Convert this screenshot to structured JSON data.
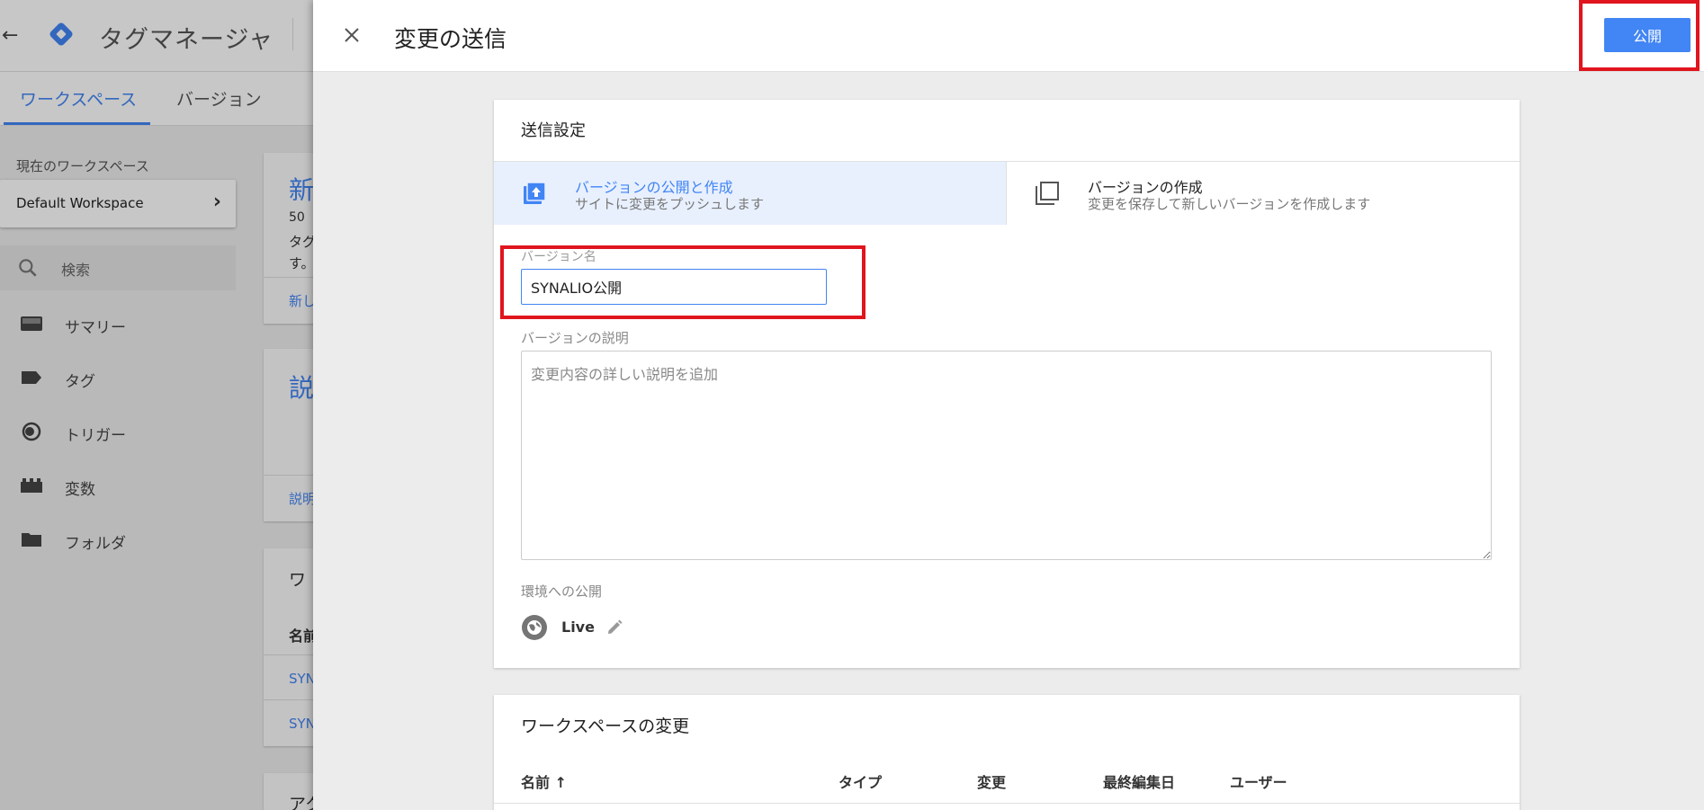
{
  "background_app": {
    "back_glyph": "←",
    "app_title": "タグマネージャ",
    "tabs": [
      "ワークスペース",
      "バージョン"
    ],
    "workspace_label": "現在のワークスペース",
    "workspace_name": "Default Workspace",
    "search_label": "検索",
    "nav_items": [
      "サマリー",
      "タグ",
      "トリガー",
      "変数",
      "フォルダ"
    ],
    "card_fragments": {
      "new_title": "新",
      "new_line1": "50",
      "new_line2": "タグ",
      "new_line3": "す。",
      "new_link": "新し",
      "desc_title": "説",
      "desc_link": "説明",
      "ws_title": "ワ",
      "name_head": "名前",
      "row1": "SYN",
      "row2": "SYN",
      "act_title": "アク"
    }
  },
  "panel": {
    "title": "変更の送信",
    "publish_label": "公開",
    "settings": {
      "title": "送信設定",
      "options": [
        {
          "title": "バージョンの公開と作成",
          "subtitle": "サイトに変更をプッシュします",
          "selected": true,
          "icon": "publish-upload-icon"
        },
        {
          "title": "バージョンの作成",
          "subtitle": "変更を保存して新しいバージョンを作成します",
          "selected": false,
          "icon": "copy-version-icon"
        }
      ],
      "version_name_label": "バージョン名",
      "version_name_value": "SYNALIO公開",
      "description_label": "バージョンの説明",
      "description_placeholder": "変更内容の詳しい説明を追加",
      "environment_label": "環境への公開",
      "environment_name": "Live"
    },
    "changes": {
      "title": "ワークスペースの変更",
      "columns": [
        "名前 ↑",
        "タイプ",
        "変更",
        "最終編集日",
        "ユーザー"
      ]
    }
  },
  "colors": {
    "accent": "#4285f4",
    "highlight_red": "#e0151e",
    "selected_option_bg": "#e8f0fe"
  }
}
